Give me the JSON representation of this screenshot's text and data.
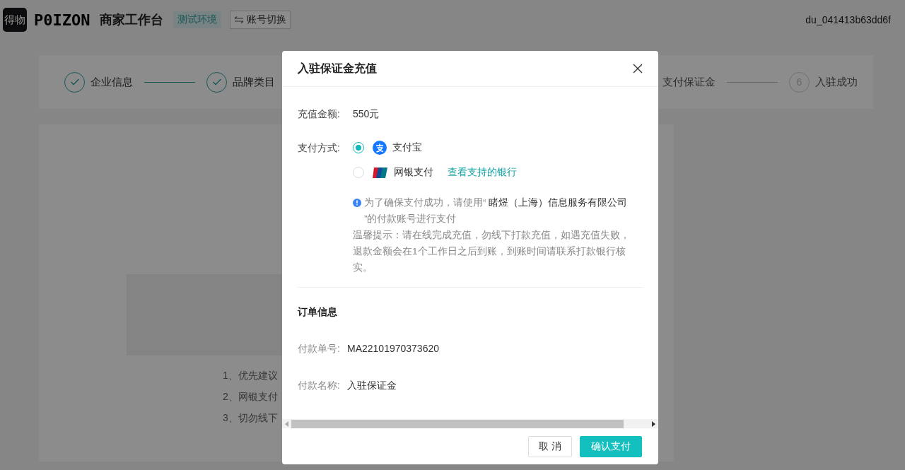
{
  "header": {
    "logo_mark": "得物",
    "logo_word": "P0IZON",
    "title": "商家工作台",
    "env_badge": "测试环境",
    "switch_button": "账号切换",
    "account": "du_041413b63dd6f"
  },
  "steps_left": [
    {
      "label": "企业信息",
      "completed": true
    },
    {
      "label": "品牌类目",
      "completed": true
    }
  ],
  "steps_right": [
    {
      "label": "支付保证金",
      "completed": false
    },
    {
      "label": "入驻成功",
      "completed": false,
      "number": "6"
    }
  ],
  "notes": [
    "1、优先建议",
    "2、网银支付",
    "3、切勿线下"
  ],
  "dialog": {
    "title": "入驻保证金充值",
    "amount_label": "充值金额:",
    "amount": "550元",
    "method_label": "支付方式:",
    "methods": [
      {
        "kind": "alipay",
        "label": "支付宝",
        "selected": true
      },
      {
        "kind": "unionpay",
        "label": "网银支付",
        "selected": false,
        "link": "查看支持的银行"
      }
    ],
    "notice": "为了确保支付成功，请使用“ **睹煜（上海）信息服务有限公司** ”的付款账号进行支付",
    "tip": "温馨提示：请在线完成充值，勿线下打款充值，如遇充值失败，退款金额会在1个工作日之后到账，到账时间请联系打款银行核实。",
    "order_title": "订单信息",
    "order_fields": [
      {
        "label": "付款单号:",
        "value": "MA22101970373620"
      },
      {
        "label": "付款名称:",
        "value": "入驻保证金"
      }
    ],
    "buttons": [
      {
        "label": "取 消",
        "kind": "secondary"
      },
      {
        "label": "确认支付",
        "kind": "primary"
      }
    ]
  }
}
